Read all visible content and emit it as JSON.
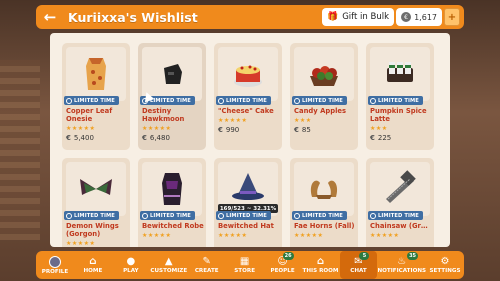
{
  "header": {
    "title": "Kuriixxa's Wishlist",
    "gift_label": "Gift in Bulk",
    "balance": "1,617"
  },
  "items": [
    {
      "name": "Copper Leaf Onesie",
      "badge": "LIMITED TIME",
      "stars": 5,
      "price": "5,400"
    },
    {
      "name": "Destiny Hawkmoon Pai...",
      "badge": "LIMITED TIME",
      "stars": 5,
      "price": "6,480"
    },
    {
      "name": "\"Cheese\" Cake",
      "badge": "LIMITED TIME",
      "stars": 5,
      "price": "990"
    },
    {
      "name": "Candy Apples",
      "badge": "LIMITED TIME",
      "stars": 3,
      "price": "85"
    },
    {
      "name": "Pumpkin Spice Latte",
      "badge": "LIMITED TIME",
      "stars": 3,
      "price": "225"
    },
    {
      "name": "Demon Wings (Gorgon)",
      "badge": "LIMITED TIME",
      "stars": 5,
      "price": ""
    },
    {
      "name": "Bewitched Robe",
      "badge": "LIMITED TIME",
      "stars": 5,
      "price": ""
    },
    {
      "name": "Bewitched Hat",
      "badge": "LIMITED TIME",
      "stars": 5,
      "price": "",
      "progress": "169/523 ~ 32.31%"
    },
    {
      "name": "Fae Horns (Fall)",
      "badge": "LIMITED TIME",
      "stars": 5,
      "price": ""
    },
    {
      "name": "Chainsaw (Gray)",
      "badge": "LIMITED TIME",
      "stars": 5,
      "price": ""
    }
  ],
  "nav": {
    "profile": "PROFILE",
    "home": "HOME",
    "play": "PLAY",
    "customize": "CUSTOMIZE",
    "create": "CREATE",
    "store": "STORE",
    "people": "PEOPLE",
    "people_count": "26",
    "this_room": "THIS ROOM",
    "chat": "CHAT",
    "chat_count": "5",
    "notifications": "NOTIFICATIONS",
    "notifications_count": "35",
    "settings": "SETTINGS"
  },
  "colors": {
    "accent": "#f08a1c",
    "badge": "#3f6ea3",
    "name": "#c0391e"
  }
}
